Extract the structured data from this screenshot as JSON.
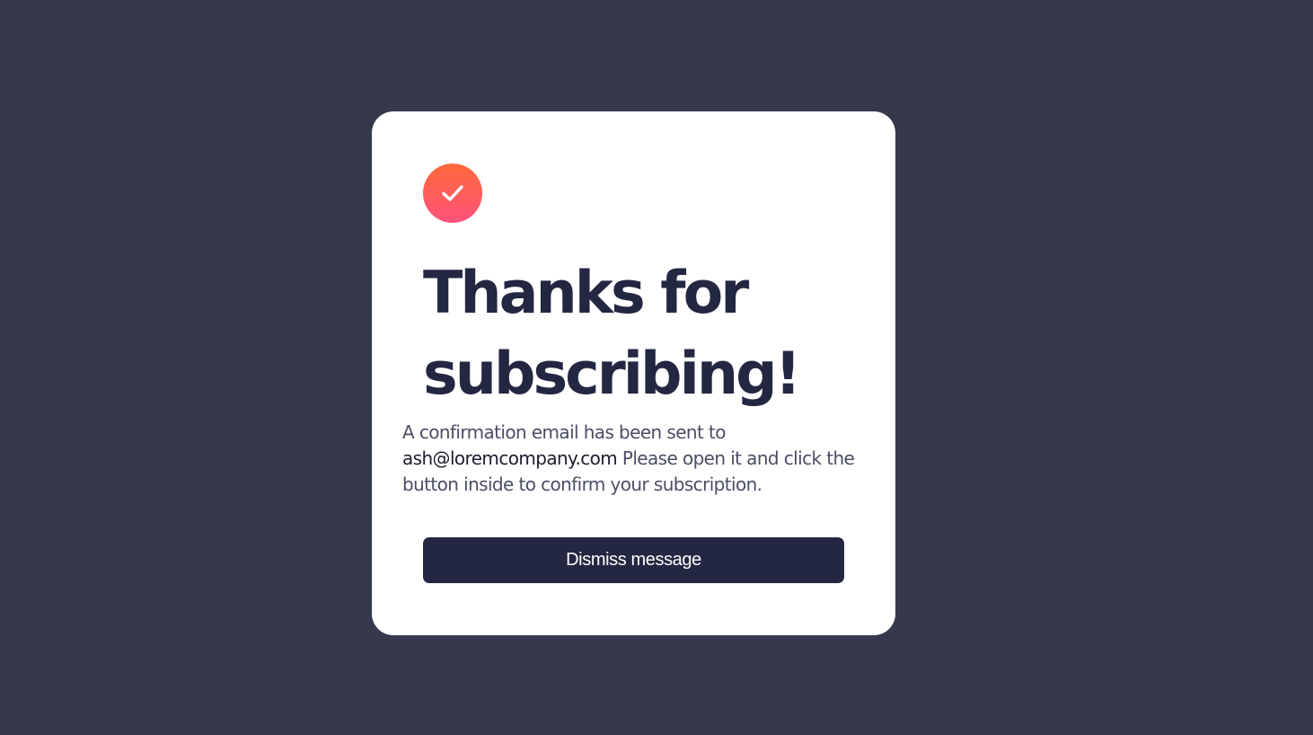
{
  "card": {
    "icon": "checkmark-circle-icon",
    "title_line1": "Thanks for",
    "title_line2": "subscribing!",
    "message_before": "A confirmation email has been sent to",
    "email": "ash@loremcompany.com",
    "message_after": "Please open it and click the button inside to confirm your subscription.",
    "dismiss_label": "Dismiss message"
  },
  "colors": {
    "background": "#36384d",
    "card": "#ffffff",
    "heading": "#242742",
    "button": "#242742",
    "icon_gradient_start": "#ff6a3a",
    "icon_gradient_end": "#ff527b"
  }
}
